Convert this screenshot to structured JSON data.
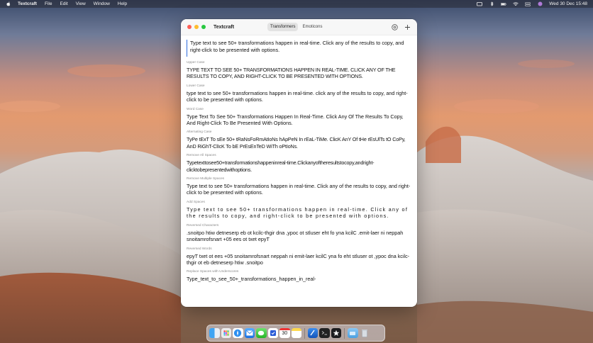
{
  "menubar": {
    "app_name": "Textcraft",
    "items": [
      "File",
      "Edit",
      "View",
      "Window",
      "Help"
    ],
    "datetime": "Wed 30 Dec  15:48"
  },
  "window": {
    "title": "Textcraft",
    "tabs": [
      {
        "label": "Transformers",
        "active": true
      },
      {
        "label": "Emoticons",
        "active": false
      }
    ]
  },
  "input": {
    "text": "Type text to see 50+ transformations happen in real-time. Click any of the results to copy, and right-click to be presented with options."
  },
  "results": [
    {
      "label": "Upper Case",
      "text": "TYPE TEXT TO SEE 50+ TRANSFORMATIONS HAPPEN IN REAL-TIME. CLICK ANY OF THE RESULTS TO COPY, AND RIGHT-CLICK TO BE PRESENTED WITH OPTIONS."
    },
    {
      "label": "Lower Case",
      "text": "type text to see 50+ transformations happen in real-time. click any of the results to copy, and right-click to be presented with options."
    },
    {
      "label": "Word Case",
      "text": "Type Text To See 50+ Transformations Happen In Real-Time. Click Any Of The Results To Copy, And Right-Click To Be Presented With Options."
    },
    {
      "label": "Alternating Case",
      "text": "TyPe tExT To sEe 50+ tRaNsFoRmAtIoNs hApPeN In rEaL-TiMe. ClicK AnY Of tHe rEsUlTs tO CoPy, AnD RiGhT-ClIcK To bE PrEsEnTeD WiTh oPtIoNs."
    },
    {
      "label": "Remove All Spaces",
      "text": "Typetexttosee50+transformationshappeninreal-time.Clickanyoftheresultstocopy,andright-clicktobepresentedwithoptions."
    },
    {
      "label": "Remove Multiple Spaces",
      "text": "Type text to see 50+ transformations happen in real-time. Click any of the results to copy, and right-click to be presented with options."
    },
    {
      "label": "Add Spaces",
      "text": "Type text to see 50+ transformations happen in real-time. Click any of the results to copy, and right-click to be presented with options."
    },
    {
      "label": "Reversed Characters",
      "text": ".snoitpo htiw detneserp eb ot kcilc-thgir dna ,ypoc ot stluser eht fo yna kcilC .emit-laer ni neppah snoitamrofsnart +05 ees ot txet epyT"
    },
    {
      "label": "Reversed Words",
      "text": "epyT txet ot ees +05 snoitamrofsnart neppah ni emit-laer kcilC yna fo eht stluser ot ,ypoc dna kcilc-thgir ot eb detneserp htiw .snoitpo"
    },
    {
      "label": "Replace Spaces with Underscores",
      "text": "Type_text_to_see_50+_transformations_happen_in_real-"
    }
  ],
  "dock": {
    "apps": [
      "finder-icon",
      "launchpad-icon",
      "safari-icon",
      "mail-icon",
      "messages-icon",
      "reminders-icon",
      "calendar-icon",
      "notes-icon",
      "xcode-icon",
      "terminal-icon",
      "textcraft-icon",
      "downloads-folder-icon",
      "trash-icon"
    ],
    "calendar_day": "30"
  }
}
